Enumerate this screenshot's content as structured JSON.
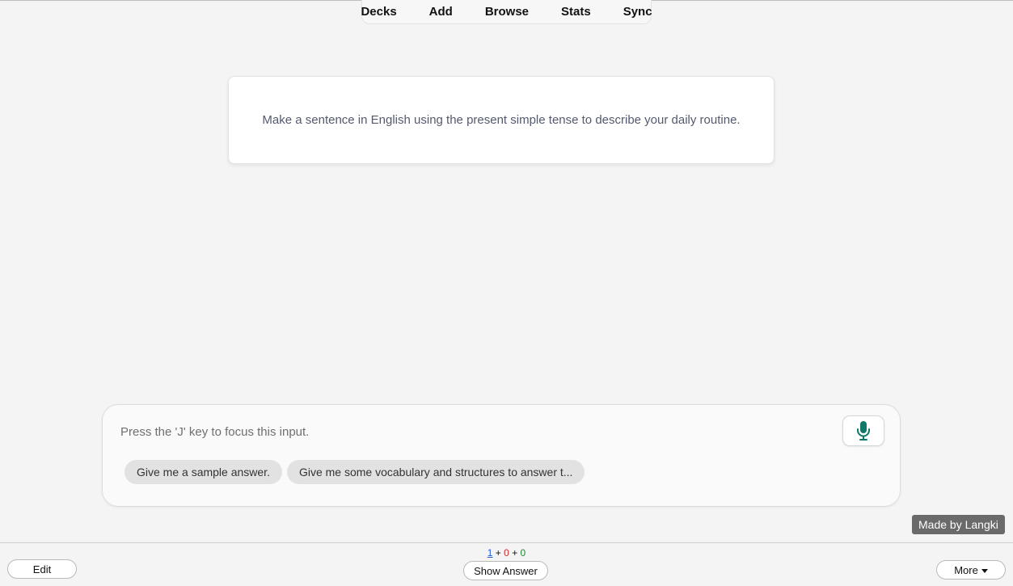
{
  "nav": {
    "items": [
      "Decks",
      "Add",
      "Browse",
      "Stats",
      "Sync"
    ]
  },
  "card": {
    "prompt": "Make a sentence in English using the present simple tense to describe your daily routine."
  },
  "chat": {
    "placeholder": "Press the 'J' key to focus this input.",
    "value": "",
    "mic_icon": "microphone-icon",
    "suggestions": [
      "Give me a sample answer.",
      "Give me some vocabulary and structures to answer t..."
    ]
  },
  "badge": {
    "text": "Made by Langki"
  },
  "bottom": {
    "edit_label": "Edit",
    "show_answer_label": "Show Answer",
    "more_label": "More",
    "counts": {
      "new": "1",
      "learn": "0",
      "review": "0",
      "separator": "+"
    }
  },
  "colors": {
    "accent_mic": "#0f7a6a",
    "new_count": "#1f5bd6",
    "learn_count": "#c62828",
    "review_count": "#1e8a2e"
  }
}
